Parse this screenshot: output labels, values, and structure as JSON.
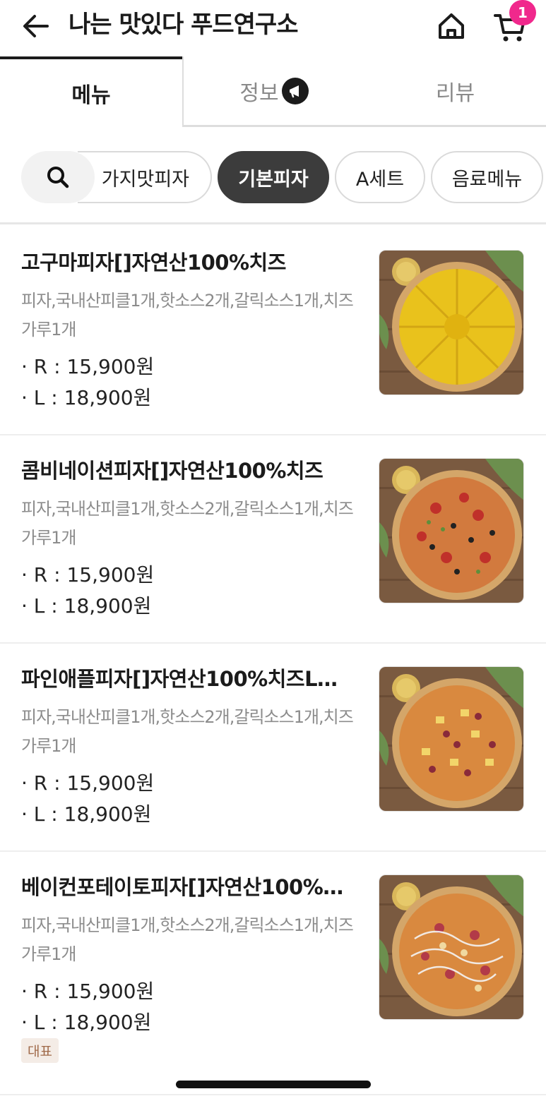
{
  "header": {
    "title": "나는 맛있다 푸드연구소",
    "cart_count": "1"
  },
  "tabs": [
    {
      "label": "메뉴"
    },
    {
      "label": "정보"
    },
    {
      "label": "리뷰"
    }
  ],
  "categories": [
    {
      "label": "가지맛피자"
    },
    {
      "label": "기본피자",
      "active": true
    },
    {
      "label": "A세트"
    },
    {
      "label": "음료메뉴"
    }
  ],
  "menu_items": [
    {
      "name": "고구마피자[]자연산100%치즈",
      "desc": "피자,국내산피클1개,핫소스2개,갈릭소스1개,치즈가루1개",
      "price_r": "· R : 15,900원",
      "price_l": "· L : 18,900원",
      "topping": "sweet-potato"
    },
    {
      "name": "콤비네이션피자[]자연산100%치즈",
      "desc": "피자,국내산피클1개,핫소스2개,갈릭소스1개,치즈가루1개",
      "price_r": "· R : 15,900원",
      "price_l": "· L : 18,900원",
      "topping": "combination"
    },
    {
      "name": "파인애플피자[]자연산100%치즈L…",
      "desc": "피자,국내산피클1개,핫소스2개,갈릭소스1개,치즈가루1개",
      "price_r": "· R : 15,900원",
      "price_l": "· L : 18,900원",
      "topping": "pineapple"
    },
    {
      "name": "베이컨포테이토피자[]자연산100%…",
      "desc": "피자,국내산피클1개,핫소스2개,갈릭소스1개,치즈가루1개",
      "price_r": "· R : 15,900원",
      "price_l": "· L : 18,900원",
      "badge": "대표",
      "topping": "bacon-potato"
    }
  ],
  "colors": {
    "accent_badge": "#f0288c",
    "active_chip": "#3c3c3c"
  }
}
